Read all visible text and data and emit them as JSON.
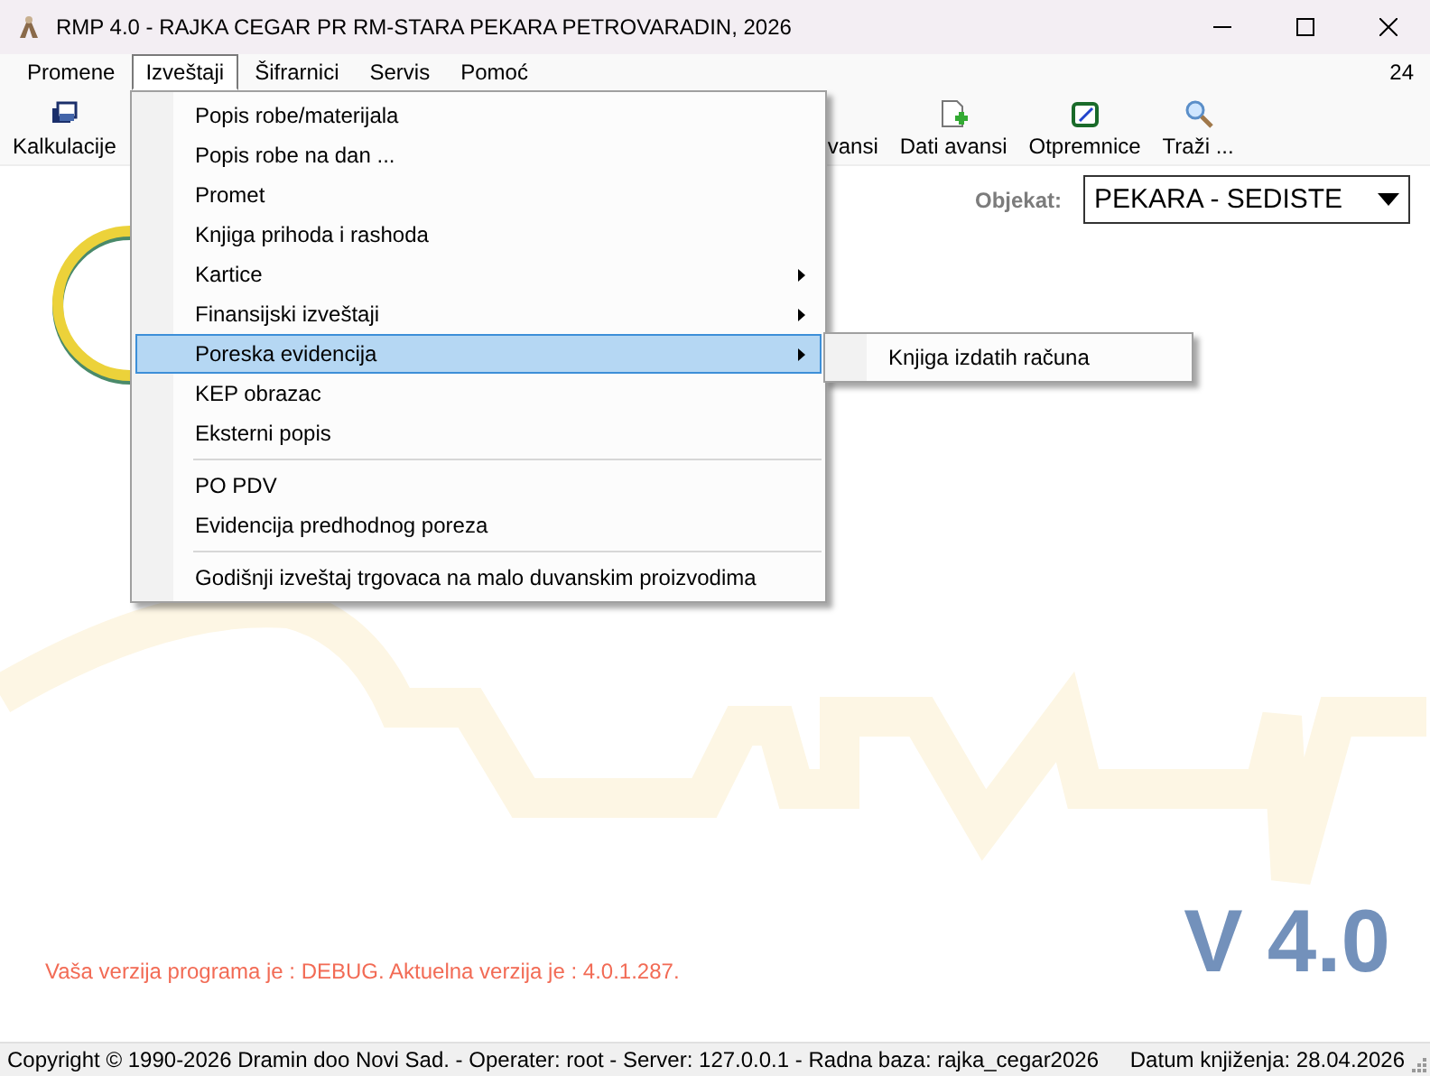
{
  "window": {
    "title": "RMP 4.0 - RAJKA CEGAR PR RM-STARA PEKARA PETROVARADIN, 2026"
  },
  "menu_bar": {
    "items": [
      {
        "label": "Promene",
        "selected": false
      },
      {
        "label": "Izveštaji",
        "selected": true
      },
      {
        "label": "Šifrarnici",
        "selected": false
      },
      {
        "label": "Servis",
        "selected": false
      },
      {
        "label": "Pomoć",
        "selected": false
      }
    ],
    "counter": "24"
  },
  "toolbar": {
    "buttons": [
      {
        "label": "Kalkulacije"
      },
      {
        "label": "vansi"
      },
      {
        "label": "Dati avansi"
      },
      {
        "label": "Otpremnice"
      },
      {
        "label": "Traži ..."
      }
    ]
  },
  "objekat": {
    "label": "Objekat:",
    "value": "PEKARA - SEDISTE"
  },
  "version_message": "Vaša verzija programa je : DEBUG. Aktuelna verzija je : 4.0.1.287.",
  "version_badge": "V 4.0",
  "status_bar": {
    "left": "Copyright © 1990-2026 Dramin doo Novi Sad. - Operater: root - Server: 127.0.0.1 - Radna baza: rajka_cegar2026",
    "right": "Datum knjiženja: 28.04.2026"
  },
  "dropdown": {
    "items": [
      {
        "kind": "item",
        "label": "Popis robe/materijala",
        "selected": false
      },
      {
        "kind": "item",
        "label": "Popis robe na dan ...",
        "selected": false
      },
      {
        "kind": "item",
        "label": "Promet",
        "selected": false
      },
      {
        "kind": "item",
        "label": "Knjiga prihoda i rashoda",
        "selected": false
      },
      {
        "kind": "submenu",
        "label": "Kartice",
        "selected": false
      },
      {
        "kind": "submenu",
        "label": "Finansijski izveštaji",
        "selected": false
      },
      {
        "kind": "submenu",
        "label": "Poreska evidencija",
        "selected": true
      },
      {
        "kind": "item",
        "label": "KEP obrazac",
        "selected": false
      },
      {
        "kind": "item",
        "label": "Eksterni popis",
        "selected": false
      },
      {
        "kind": "separator"
      },
      {
        "kind": "item",
        "label": "PO PDV",
        "selected": false
      },
      {
        "kind": "item",
        "label": "Evidencija predhodnog poreza",
        "selected": false
      },
      {
        "kind": "separator"
      },
      {
        "kind": "item",
        "label": "Godišnji izveštaj trgovaca na malo duvanskim proizvodima",
        "selected": false
      }
    ]
  },
  "submenu": {
    "items": [
      {
        "label": "Knjiga izdatih računa",
        "selected": false
      }
    ]
  }
}
